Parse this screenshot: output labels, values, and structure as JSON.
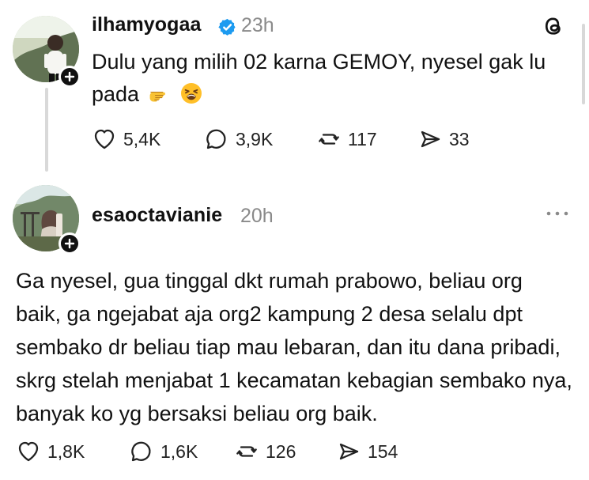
{
  "post_1": {
    "author": "ilhamyogaa",
    "time": "23h",
    "verified_icon": "verified-badge-icon",
    "brand_icon": "threads-logo-icon",
    "text_main": "Dulu yang milih 02 karna GEMOY, nyesel gak lu pada",
    "emojis": [
      "pointing-left-hand-emoji",
      "tired-face-emoji"
    ],
    "actions": {
      "likes": "5,4K",
      "replies": "3,9K",
      "reposts": "117",
      "shares": "33"
    }
  },
  "post_2": {
    "author": "esaoctavianie",
    "time": "20h",
    "more_icon": "more-horizontal-icon",
    "text": "Ga nyesel, gua tinggal dkt rumah prabowo, beliau org baik, ga ngejabat aja org2 kampung 2 desa selalu dpt sembako dr beliau tiap mau lebaran, dan itu dana pribadi, skrg stelah menjabat 1 kecamatan kebagian sembako nya, banyak ko yg bersaksi beliau org baik.",
    "actions": {
      "likes": "1,8K",
      "replies": "1,6K",
      "reposts": "126",
      "shares": "154"
    }
  },
  "colors": {
    "text": "#111111",
    "muted": "#8a8a8a",
    "verified": "#1d9bf0",
    "line": "#d9d9d9"
  }
}
